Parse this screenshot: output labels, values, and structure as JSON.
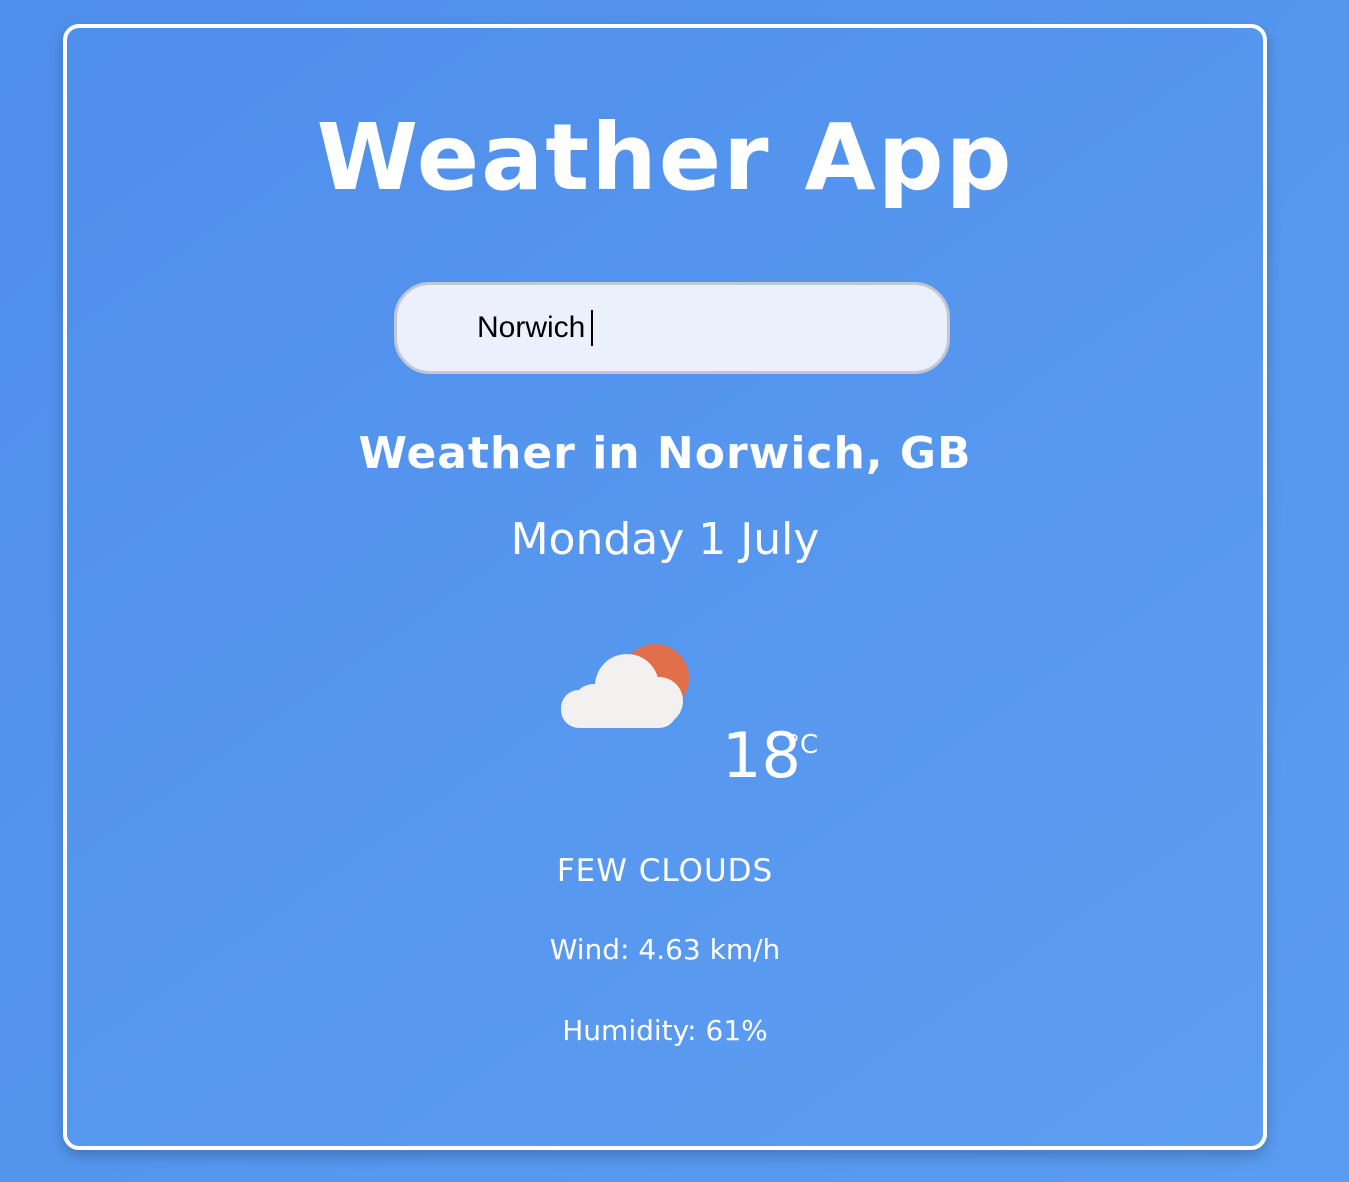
{
  "app": {
    "title": "Weather App"
  },
  "search": {
    "value": "Norwich"
  },
  "weather": {
    "location": "Weather in Norwich, GB",
    "date": "Monday 1 July",
    "icon": "few-clouds-icon",
    "temperature": "18",
    "unit": "°C",
    "description": "FEW CLOUDS",
    "wind": "Wind: 4.63 km/h",
    "humidity": "Humidity: 61%"
  },
  "colors": {
    "background": "#5592ec",
    "card_border": "#ffffff",
    "text": "#ffffff",
    "search_bg": "#ebf0fc",
    "sun": "#e06f4a",
    "cloud": "#f3f1ef"
  }
}
